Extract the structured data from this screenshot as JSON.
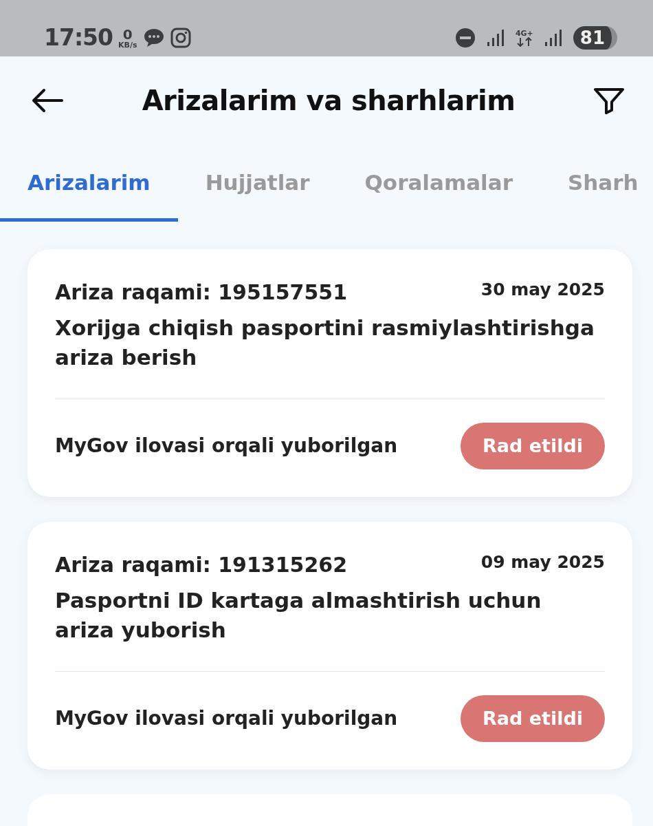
{
  "status_bar": {
    "time": "17:50",
    "speed_value": "0",
    "speed_unit": "KB/s",
    "network": "4G+",
    "battery": "81"
  },
  "header": {
    "title": "Arizalarim va sharhlarim"
  },
  "tabs": [
    {
      "label": "Arizalarim",
      "selected": true
    },
    {
      "label": "Hujjatlar",
      "selected": false
    },
    {
      "label": "Qoralamalar",
      "selected": false
    },
    {
      "label": "Sharh",
      "selected": false
    }
  ],
  "applications": [
    {
      "number": "Ariza raqami: 195157551",
      "date": "30 may 2025",
      "title": "Xorijga chiqish pasportini rasmiylashtirishga ariza berish",
      "source": "MyGov ilovasi orqali yuborilgan",
      "status": {
        "label": "Rad etildi",
        "color": "#d97674"
      }
    },
    {
      "number": "Ariza raqami: 191315262",
      "date": "09 may 2025",
      "title": "Pasportni ID kartaga almashtirish uchun ariza yuborish",
      "source": "MyGov ilovasi orqali yuborilgan",
      "status": {
        "label": "Rad etildi",
        "color": "#d97674"
      }
    }
  ]
}
